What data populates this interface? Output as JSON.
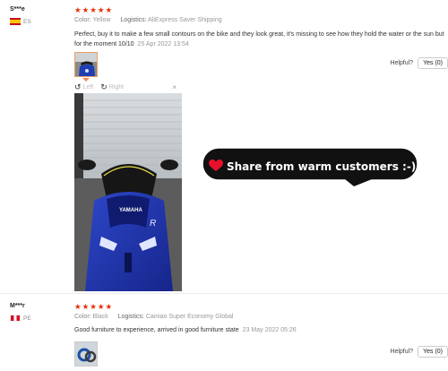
{
  "reviews": [
    {
      "user": "S***e",
      "country": "ES",
      "stars": "★★★★★",
      "color_label": "Color:",
      "color_value": "Yellow",
      "logistics_label": "Logistics:",
      "logistics_value": "AliExpress Saver Shipping",
      "text": "Perfect, buy it to make a few small contours on the bike and they look great, it's missing to see how they hold the water or the sun but for the moment 10/10",
      "date": "25 Apr 2022 13:54",
      "helpful_label": "Helpful?",
      "yes_label": "Yes (0)"
    },
    {
      "user": "M***r",
      "country": "PE",
      "stars": "★★★★★",
      "color_label": "Color:",
      "color_value": "Black",
      "logistics_label": "Logistics:",
      "logistics_value": "Cainiao Super Economy Global",
      "text": "Good furniture to experience, arrived in good furniture state",
      "date": "23 May 2022 05:26",
      "helpful_label": "Helpful?",
      "yes_label": "Yes (0)"
    }
  ],
  "viewer": {
    "rotate_left": "Left",
    "rotate_right": "Right",
    "close": "×"
  },
  "banner": {
    "text": "Share from warm customers :-)"
  },
  "icons": {
    "rotate_left": "rotate-left-icon",
    "rotate_right": "rotate-right-icon",
    "close": "close-icon",
    "heart": "heart-icon",
    "star": "star-icon"
  },
  "colors": {
    "star": "#e62e04",
    "bubble": "#111111",
    "heart": "#e8112d",
    "thumb_active_border": "#e8a065"
  }
}
